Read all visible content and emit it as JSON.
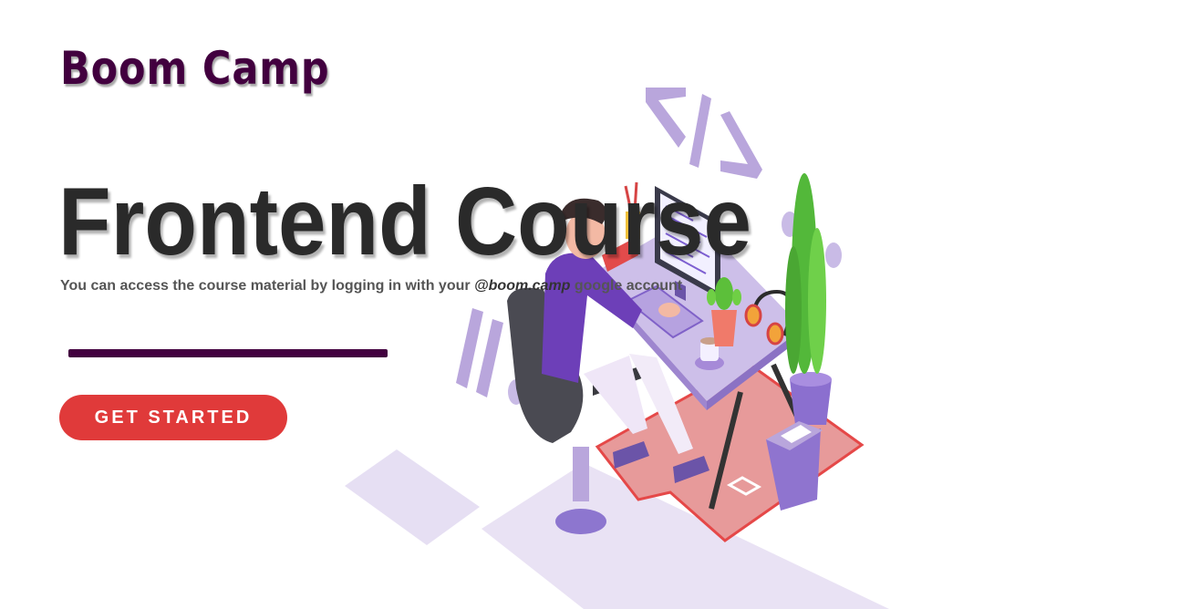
{
  "header": {
    "brand": "Boom Camp"
  },
  "hero": {
    "title": "Frontend Course",
    "subtitle_prefix": "You can access the course material by logging in with your ",
    "subtitle_domain": "@boom.camp",
    "subtitle_suffix": " google account",
    "cta_label": "GET STARTED"
  },
  "illustration": {
    "code_symbol": "</>",
    "description_icon": "developer-at-desk-illustration"
  },
  "colors": {
    "brand": "#42003f",
    "accent": "#e03a3a",
    "headline": "#2a2a2a",
    "lavender": "#b9a6dc",
    "purple": "#6b3fb0"
  }
}
